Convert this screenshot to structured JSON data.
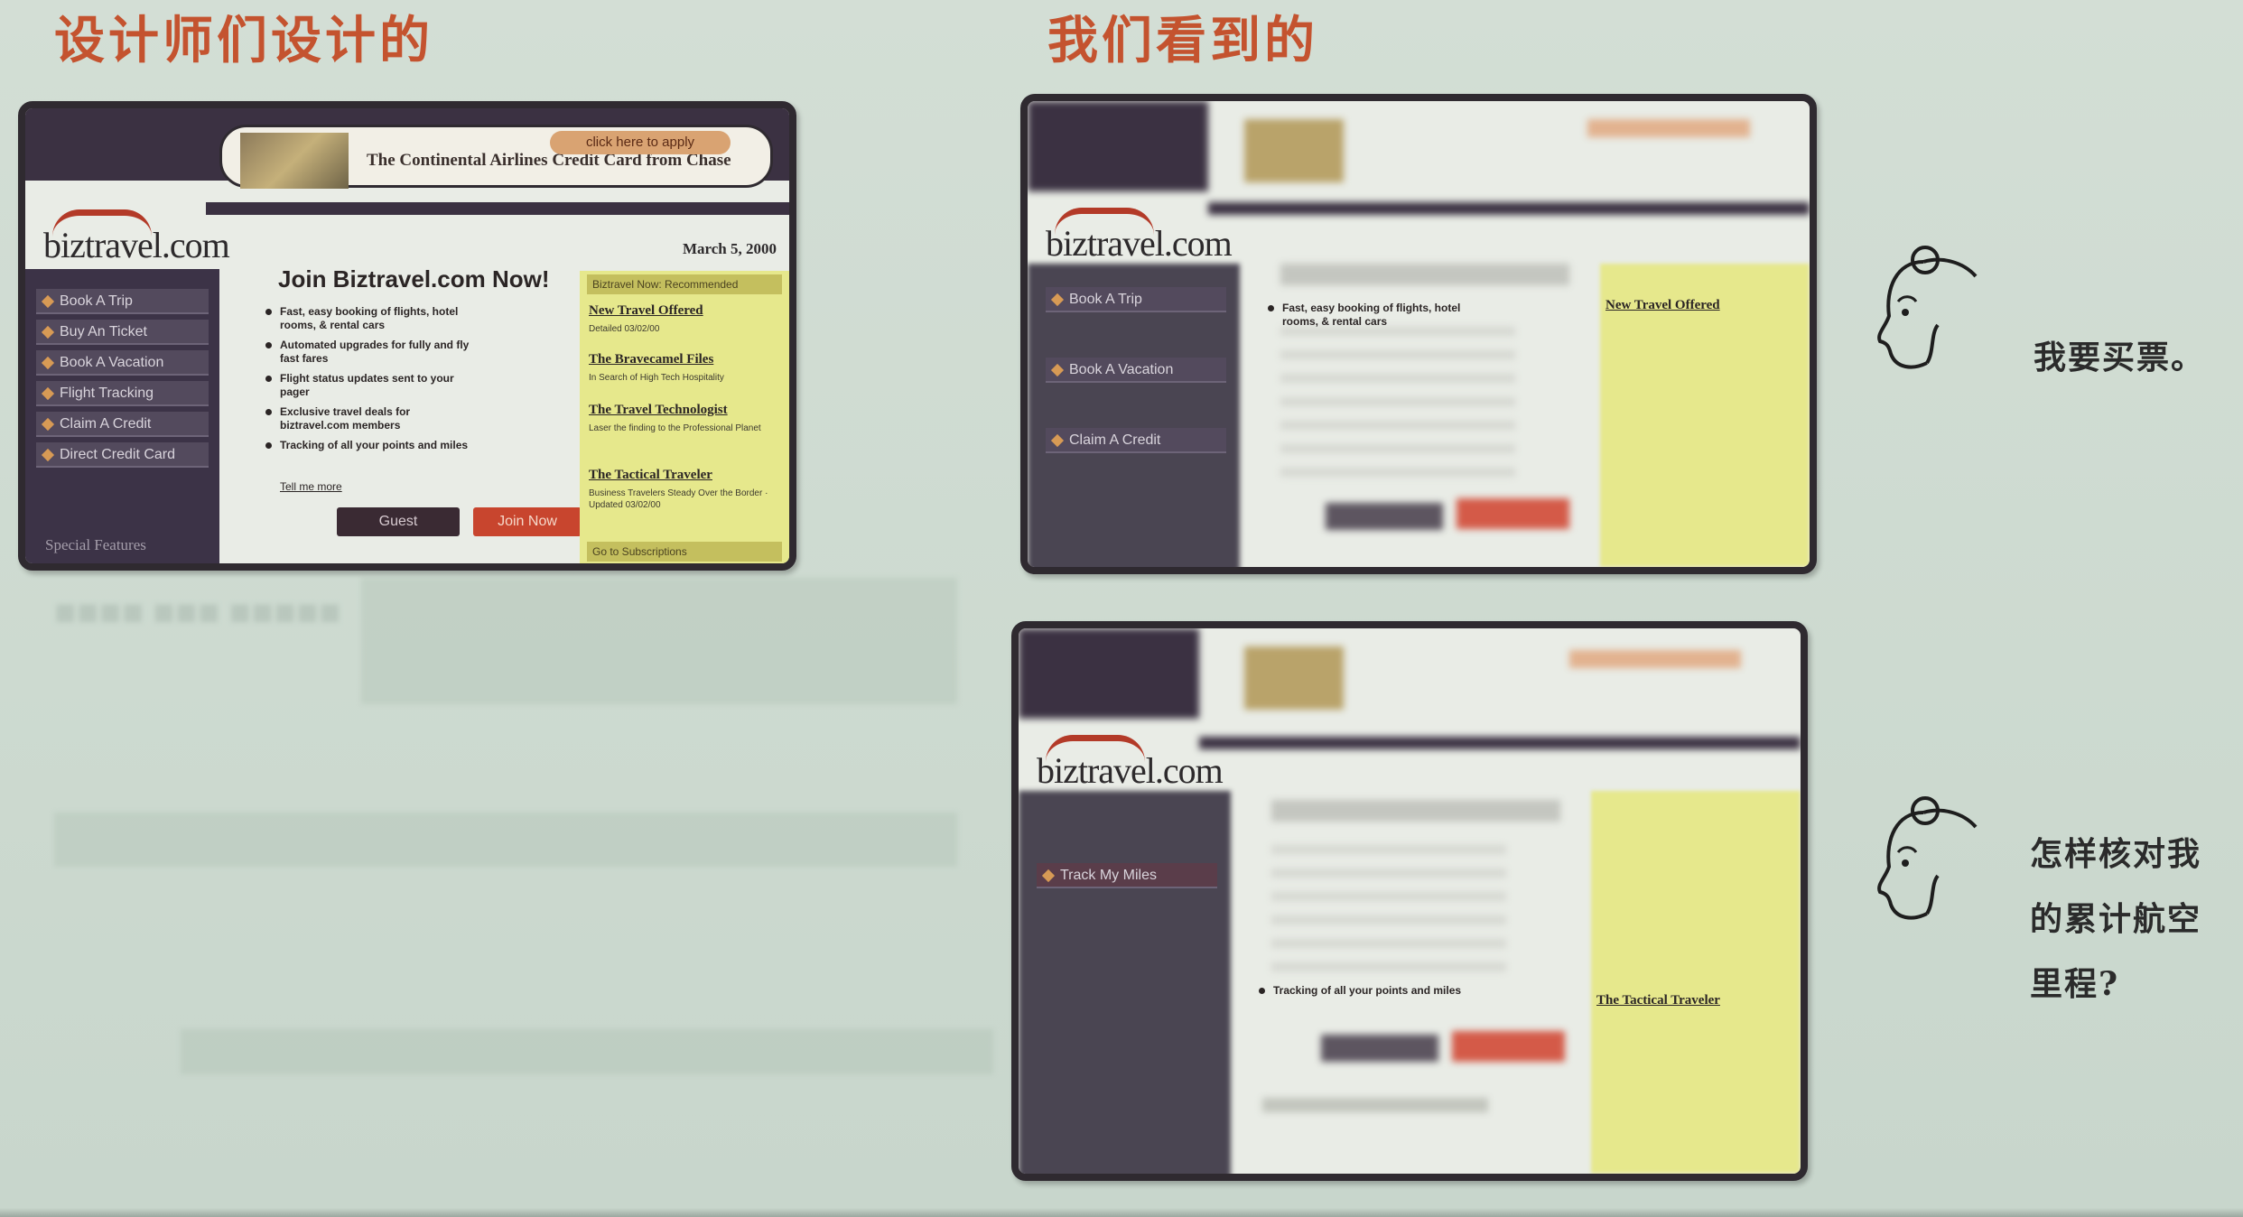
{
  "headings": {
    "designer": "设计师们设计的",
    "users": "我们看到的"
  },
  "site": {
    "logo": "biztravel.com",
    "banner_text": "The Continental Airlines Credit Card from Chase",
    "banner_button": "click here to apply",
    "date": "March 5, 2000",
    "join_title": "Join Biztravel.com Now!",
    "sidebar": [
      "Book A Trip",
      "Buy An Ticket",
      "Book A Vacation",
      "Flight Tracking",
      "Claim A Credit",
      "Direct Credit Card"
    ],
    "sidebar_footer": "Special Features",
    "bullets": [
      "Fast, easy booking of flights, hotel rooms, & rental cars",
      "Automated upgrades for fully and fly fast fares",
      "Flight status updates sent to your pager",
      "Exclusive travel deals for biztravel.com members",
      "Tracking of all your points and miles"
    ],
    "more_link": "Tell me more",
    "guest_button": "Guest",
    "join_button": "Join Now",
    "right_header": "Biztravel Now: Recommended",
    "right_links": [
      {
        "title": "New Travel Offered",
        "sub": "Detailed 03/02/00"
      },
      {
        "title": "The Bravecamel Files",
        "sub": "In Search of High Tech Hospitality"
      },
      {
        "title": "The Travel Technologist",
        "sub": "Laser the finding to the Professional Planet"
      },
      {
        "title": "The Tactical Traveler",
        "sub": "Business Travelers Steady Over the Border · Updated 03/02/00"
      }
    ],
    "right_footer": "Go to Subscriptions"
  },
  "view1": {
    "sharp_bullet": "Fast, easy booking of flights, hotel rooms, & rental cars",
    "sharp_link": "New Travel Offered",
    "sharp_menu": [
      "Book A Trip",
      "Book A Vacation",
      "Claim A Credit"
    ]
  },
  "view2": {
    "sharp_bullet": "Tracking of all your points and miles",
    "sharp_link": "The Tactical Traveler",
    "sharp_menu": [
      "Track My Miles"
    ]
  },
  "thoughts": {
    "buy": "我要买票。",
    "miles_lines": [
      "怎样核对我",
      "的累计航空",
      "里程?"
    ]
  },
  "colors": {
    "heading": "#c4532f",
    "frame": "#2f2a30",
    "sidebar": "#3c3347",
    "accent_red": "#c8452e",
    "yellow": "#e6e88c",
    "background": "#cfdbd0"
  }
}
